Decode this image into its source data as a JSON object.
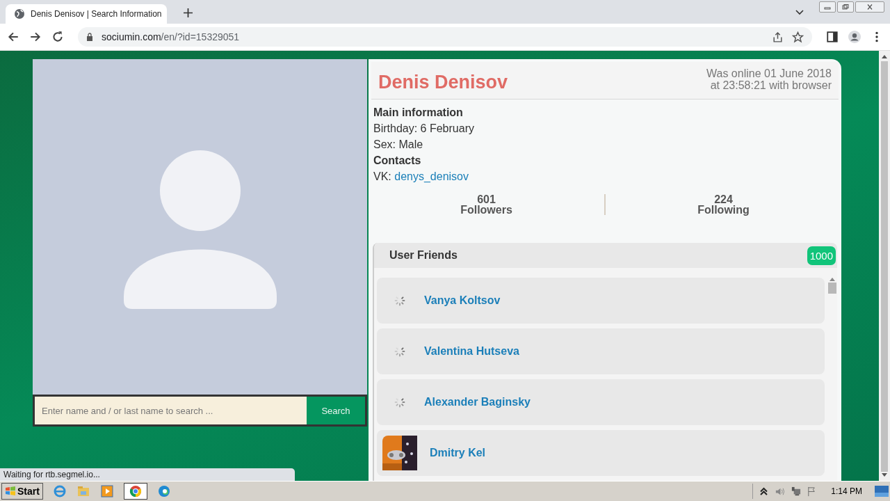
{
  "browser": {
    "tab_title": "Denis Denisov | Search Information",
    "url_host": "sociumin.com",
    "url_path": "/en/?id=15329051",
    "status": "Waiting for rtb.segmel.io..."
  },
  "profile": {
    "name": "Denis Denisov",
    "last_seen": [
      "Was online 01 June 2018",
      "at 23:58:21 with browser"
    ],
    "main_heading": "Main information",
    "birthday": "Birthday: 6 February",
    "sex": "Sex: Male",
    "contacts_heading": "Contacts",
    "vk_label": "VK:",
    "vk_link": "denys_denisov",
    "stats": [
      {
        "value": "601",
        "label": "Followers"
      },
      {
        "value": "224",
        "label": "Following"
      }
    ]
  },
  "search": {
    "placeholder": "Enter name and / or last name to search ...",
    "button": "Search"
  },
  "friends": {
    "title": "User Friends",
    "count": "1000",
    "items": [
      {
        "name": "Vanya Koltsov",
        "kind": "loading"
      },
      {
        "name": "Valentina Hutseva",
        "kind": "loading"
      },
      {
        "name": "Alexander Baginsky",
        "kind": "loading"
      },
      {
        "name": "Dmitry Kel"
      }
    ]
  },
  "taskbar": {
    "start": "Start",
    "time": "1:14 PM"
  }
}
